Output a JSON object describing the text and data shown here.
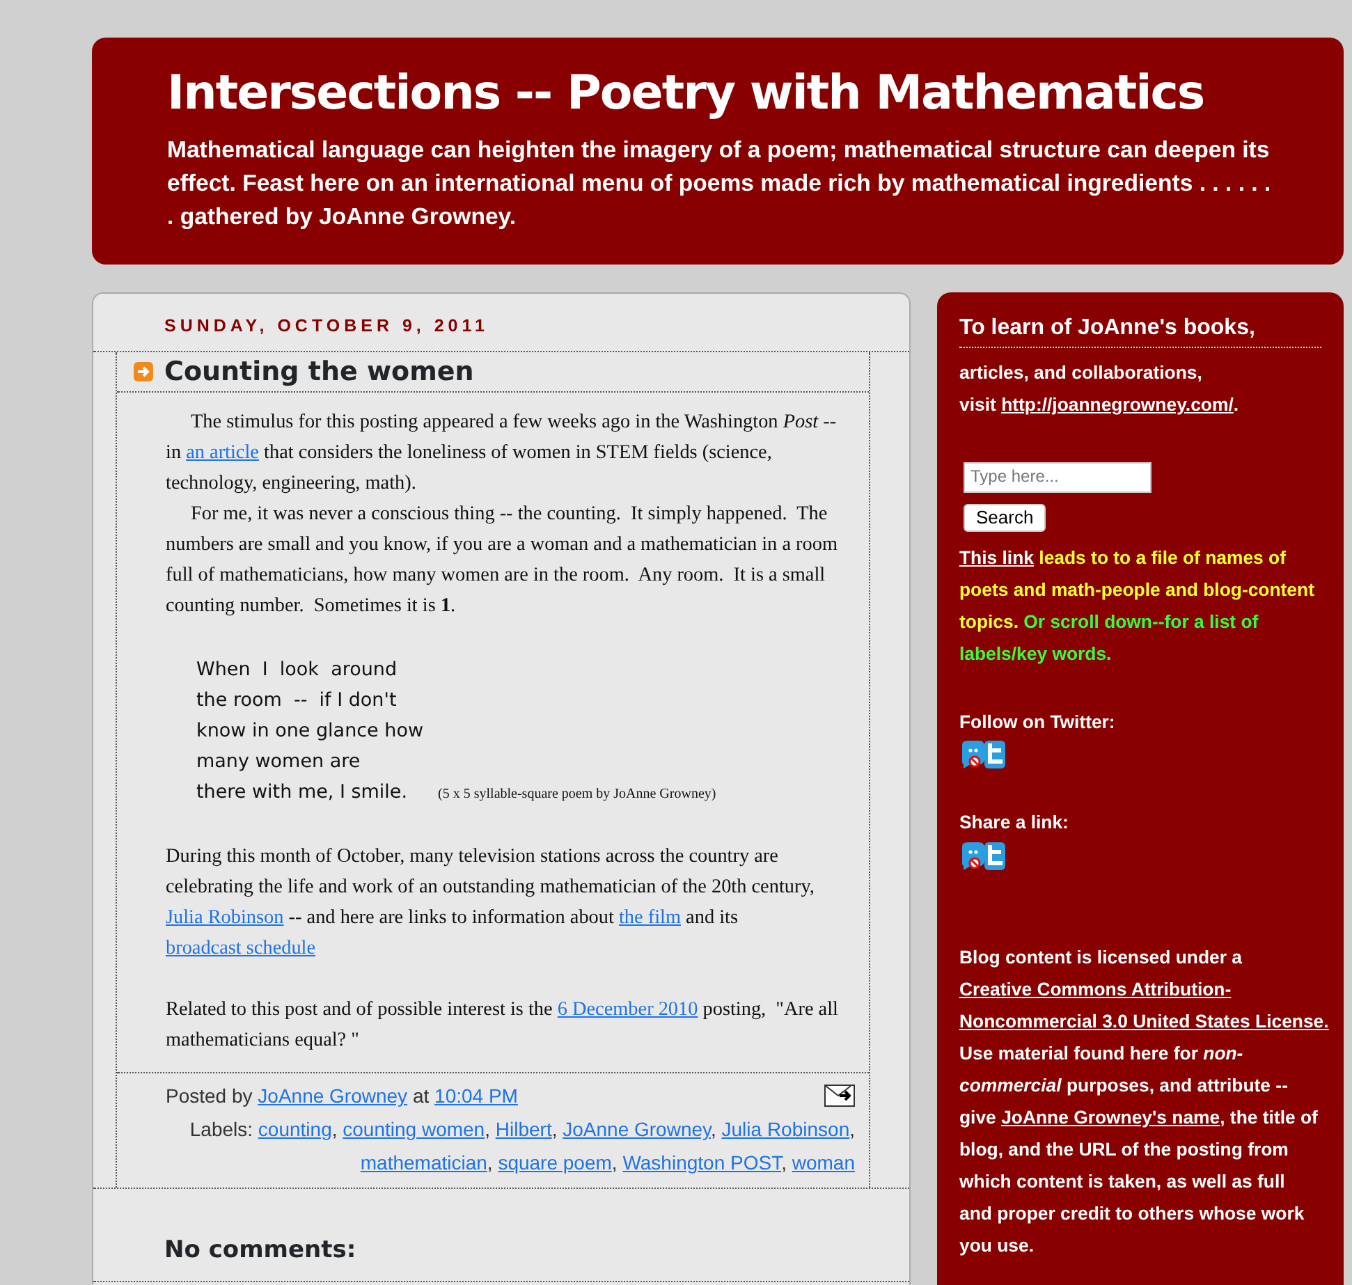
{
  "blog": {
    "title": "Intersections -- Poetry with Mathematics",
    "description": "Mathematical language can heighten the imagery of a poem; mathematical structure can deepen its effect. Feast here on an international menu of poems made rich by mathematical ingredients . . . . . . . gathered by JoAnne Growney."
  },
  "post": {
    "date": "SUNDAY, OCTOBER 9, 2011",
    "title": "Counting the women",
    "body": [
      {
        "kind": "paragraph",
        "indent": true,
        "segments": [
          {
            "kind": "text",
            "text": "The stimulus for this posting appeared a few weeks ago in the Washington *Post* -- in "
          },
          {
            "kind": "link",
            "text": "an article"
          },
          {
            "kind": "text",
            "text": " that considers the loneliness of women in STEM fields (science, technology, engineering, math)."
          }
        ]
      },
      {
        "kind": "paragraph",
        "indent": true,
        "segments": [
          {
            "kind": "text",
            "text": "For me, it was never a conscious thing -- the counting.  It simply happened.  The numbers are small and you know, if you are a woman and a mathematician in a room full of mathematicians, how many women are in the room.  Any room.  It is a small counting number.  Sometimes it is **1**."
          }
        ]
      },
      {
        "kind": "poem",
        "lines": [
          "When  I  look  around",
          "the room  --  if I don't",
          "know in one glance how",
          "many women are",
          "there with me, I smile."
        ],
        "caption": "(5 x 5 syllable-square poem by JoAnne Growney)"
      },
      {
        "kind": "paragraph",
        "indent": false,
        "segments": [
          {
            "kind": "text",
            "text": "During this month of October, many television stations across the country are celebrating the life and work of an outstanding mathematician of the 20th century, "
          },
          {
            "kind": "link",
            "text": "Julia Robinson"
          },
          {
            "kind": "text",
            "text": " -- and here are links to information about "
          },
          {
            "kind": "link",
            "text": "the film"
          },
          {
            "kind": "text",
            "text": " and its "
          },
          {
            "kind": "link",
            "text": "broadcast schedule"
          }
        ]
      },
      {
        "kind": "paragraph",
        "indent": false,
        "segments": [
          {
            "kind": "text",
            "text": "Related to this post and of possible interest is the "
          },
          {
            "kind": "link",
            "text": "6 December 2010"
          },
          {
            "kind": "text",
            "text": " posting,  \"Are all mathematicians equal? \""
          }
        ]
      }
    ],
    "posted": [
      {
        "kind": "text",
        "text": "Posted by "
      },
      {
        "kind": "link",
        "text": "JoAnne Growney"
      },
      {
        "kind": "text",
        "text": " at "
      },
      {
        "kind": "link",
        "text": "10:04 PM"
      }
    ],
    "labels": [
      {
        "kind": "text",
        "text": "Labels: "
      },
      {
        "kind": "link",
        "text": "counting"
      },
      {
        "kind": "text",
        "text": ", "
      },
      {
        "kind": "link",
        "text": "counting women"
      },
      {
        "kind": "text",
        "text": ", "
      },
      {
        "kind": "link",
        "text": "Hilbert"
      },
      {
        "kind": "text",
        "text": ", "
      },
      {
        "kind": "link",
        "text": "JoAnne Growney"
      },
      {
        "kind": "text",
        "text": ", "
      },
      {
        "kind": "link",
        "text": "Julia Robinson"
      },
      {
        "kind": "text",
        "text": ", "
      },
      {
        "kind": "link",
        "text": "mathematician"
      },
      {
        "kind": "text",
        "text": ", "
      },
      {
        "kind": "link",
        "text": "square poem"
      },
      {
        "kind": "text",
        "text": ", "
      },
      {
        "kind": "link",
        "text": "Washington POST"
      },
      {
        "kind": "text",
        "text": ", "
      },
      {
        "kind": "link",
        "text": "woman"
      }
    ],
    "comments_heading": "No comments:"
  },
  "sidebar": [
    {
      "kind": "intro",
      "title": "To learn of JoAnne's books,",
      "lines": [
        [
          {
            "kind": "text",
            "text": "articles, and collaborations,"
          }
        ],
        [
          {
            "kind": "text",
            "text": "visit "
          },
          {
            "kind": "link",
            "text": "http://joannegrowney.com/"
          },
          {
            "kind": "text",
            "text": "."
          }
        ]
      ]
    },
    {
      "kind": "search",
      "placeholder": "Type here...",
      "button": "Search"
    },
    {
      "kind": "text",
      "segments": [
        {
          "kind": "link",
          "text": "This link"
        },
        {
          "kind": "text",
          "text": " leads to to a file of names of poets and math-people and blog-content topics.",
          "color": "#ffff33"
        },
        {
          "kind": "text",
          "text": " Or scroll down--for a list of labels/key words.",
          "color": "#33ff33"
        }
      ]
    },
    {
      "kind": "social",
      "title": "Follow on Twitter:"
    },
    {
      "kind": "social",
      "title": "Share a link:"
    },
    {
      "kind": "text",
      "segments": [
        {
          "kind": "text",
          "text": "Blog content is licensed under a "
        },
        {
          "kind": "link",
          "text": "Creative Commons Attribution-"
        },
        {
          "kind": "link",
          "text": "Noncommercial 3.0 United States License."
        },
        {
          "kind": "text",
          "text": " Use material found here for *non-commercial* purposes, and attribute -- give "
        },
        {
          "kind": "link",
          "text": "JoAnne Growney's name"
        },
        {
          "kind": "text",
          "text": ", the title of blog, and the URL of the posting from which content is taken, as well as full and proper credit to others whose work you use."
        }
      ]
    }
  ]
}
